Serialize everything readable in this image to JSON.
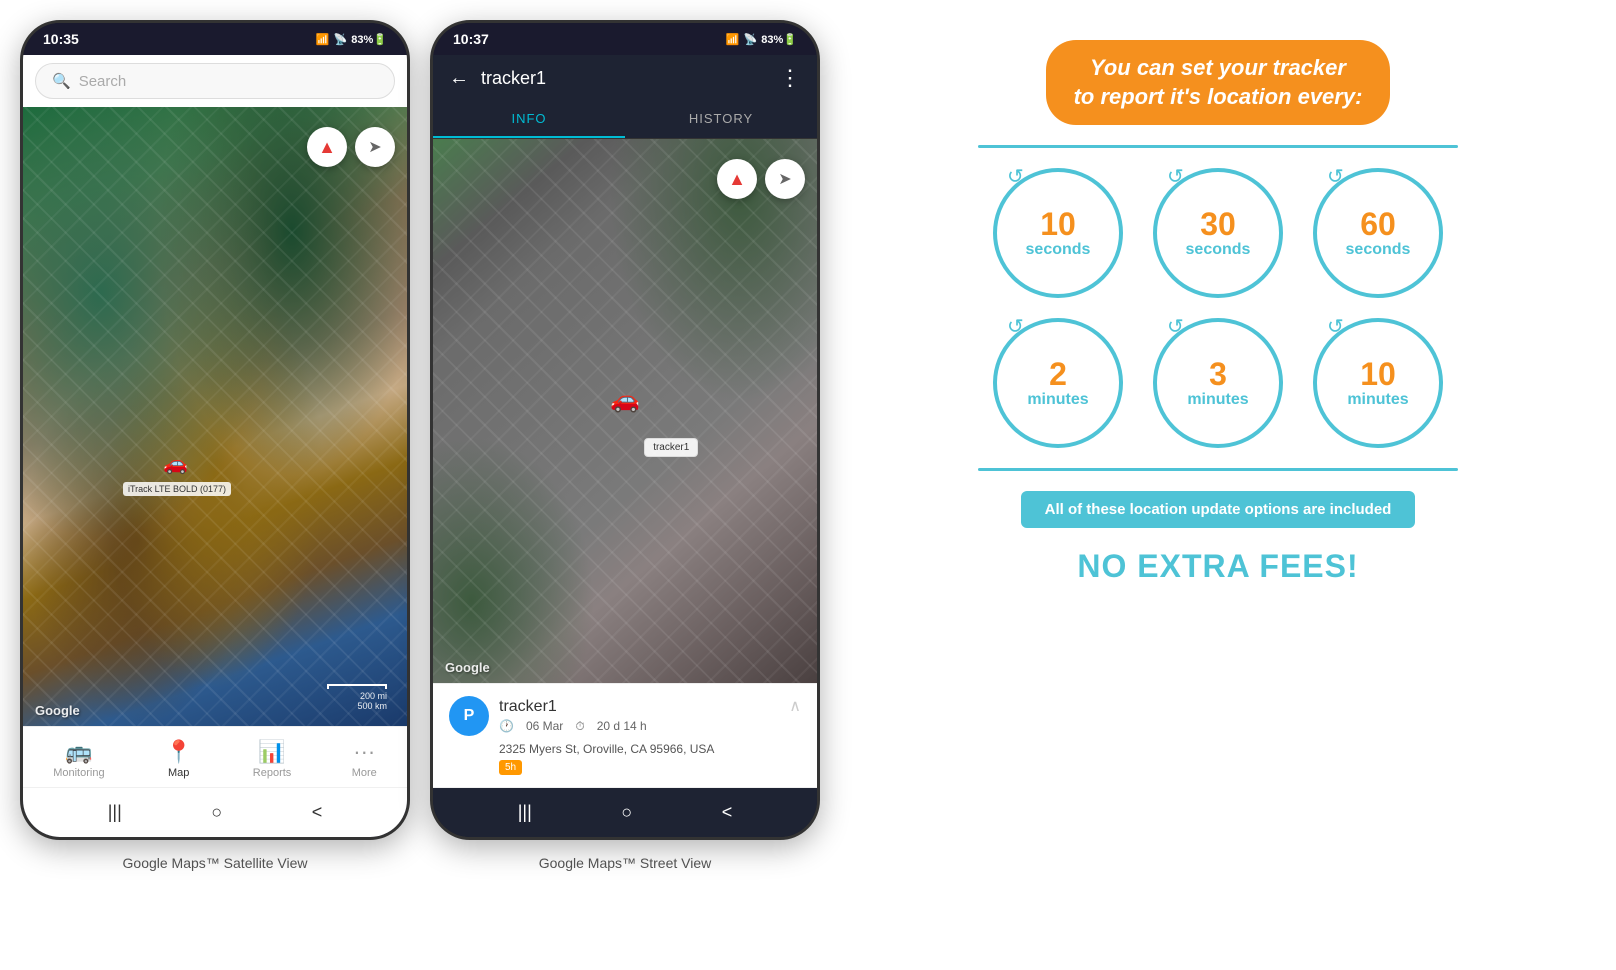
{
  "phone1": {
    "status_bar": {
      "time": "10:35",
      "signal": "▲▼ .all 83%"
    },
    "search_placeholder": "Search",
    "map_label": "iTrack LTE BOLD (0177)",
    "google_watermark": "Google",
    "scale_200mi": "200 mi",
    "scale_500km": "500 km",
    "nav_items": [
      {
        "label": "Monitoring",
        "icon": "🚌"
      },
      {
        "label": "Map",
        "icon": "📍",
        "active": true
      },
      {
        "label": "Reports",
        "icon": "📊"
      },
      {
        "label": "More",
        "icon": "···"
      }
    ],
    "caption": "Google Maps™ Satellite View"
  },
  "phone2": {
    "status_bar": {
      "time": "10:37",
      "signal": "▲▼ .all 83%"
    },
    "header": {
      "back_icon": "←",
      "title": "tracker1",
      "menu_icon": "⋮"
    },
    "tabs": [
      {
        "label": "INFO",
        "active": true
      },
      {
        "label": "HISTORY",
        "active": false
      }
    ],
    "google_watermark": "Google",
    "tracker_label": "tracker1",
    "tracker_device": "tracker1",
    "tracker_date": "06 Mar",
    "tracker_duration": "20 d 14 h",
    "tracker_address": "2325 Myers St, Oroville, CA 95966, USA",
    "tracker_badge": "5h",
    "caption": "Google Maps™ Street View"
  },
  "infographic": {
    "title_line1": "You can set your tracker",
    "title_line2": "to report it's location every:",
    "circles": [
      {
        "number": "10",
        "unit": "seconds"
      },
      {
        "number": "30",
        "unit": "seconds"
      },
      {
        "number": "60",
        "unit": "seconds"
      },
      {
        "number": "2",
        "unit": "minutes"
      },
      {
        "number": "3",
        "unit": "minutes"
      },
      {
        "number": "10",
        "unit": "minutes"
      }
    ],
    "no_fees_line": "All of these location update options are included",
    "no_extra_fees": "NO EXTRA FEES!"
  }
}
